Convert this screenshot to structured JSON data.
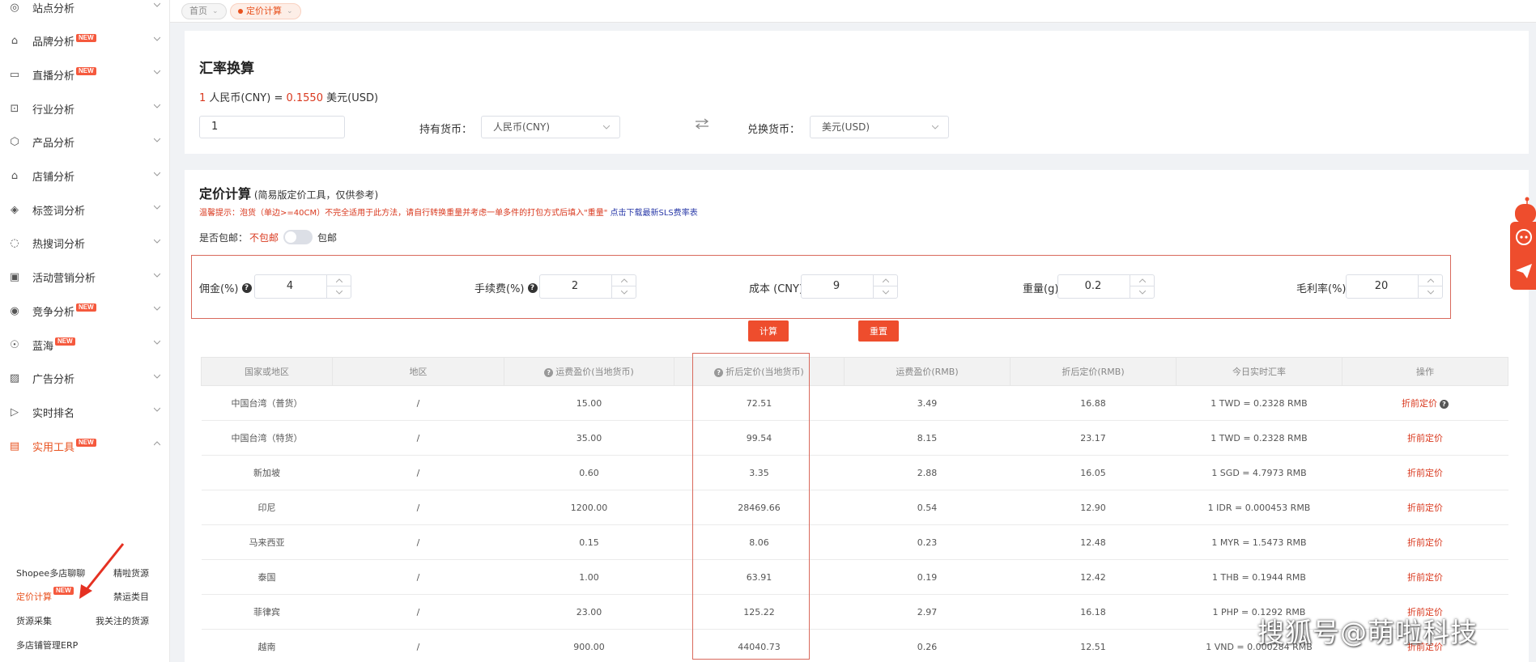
{
  "sidebar": {
    "items": [
      {
        "label": "站点分析",
        "icon": "globe-icon",
        "new": false
      },
      {
        "label": "品牌分析",
        "icon": "bag-icon",
        "new": true
      },
      {
        "label": "直播分析",
        "icon": "live-icon",
        "new": true
      },
      {
        "label": "行业分析",
        "icon": "search-doc-icon",
        "new": false
      },
      {
        "label": "产品分析",
        "icon": "box-icon",
        "new": false
      },
      {
        "label": "店铺分析",
        "icon": "shop-icon",
        "new": false
      },
      {
        "label": "标签词分析",
        "icon": "tag-icon",
        "new": false
      },
      {
        "label": "热搜词分析",
        "icon": "chat-icon",
        "new": false
      },
      {
        "label": "活动营销分析",
        "icon": "gift-icon",
        "new": false
      },
      {
        "label": "竞争分析",
        "icon": "compete-icon",
        "new": true
      },
      {
        "label": "蓝海",
        "icon": "ocean-icon",
        "new": true
      },
      {
        "label": "广告分析",
        "icon": "chart-icon",
        "new": false
      },
      {
        "label": "实时排名",
        "icon": "rank-icon",
        "new": false
      },
      {
        "label": "实用工具",
        "icon": "toolbox-icon",
        "new": true,
        "active": true
      }
    ],
    "new_badge": "NEW",
    "sub_items": [
      {
        "label": "Shopee多店聊聊"
      },
      {
        "label": "精啦货源"
      },
      {
        "label": "定价计算",
        "active": true,
        "new": true
      },
      {
        "label": "禁运类目"
      },
      {
        "label": "货源采集"
      },
      {
        "label": "我关注的货源"
      },
      {
        "label": "多店铺管理ERP"
      }
    ]
  },
  "tabs": [
    {
      "label": "首页",
      "active": false
    },
    {
      "label": "定价计算",
      "active": true
    }
  ],
  "exchange": {
    "title": "汇率换算",
    "rate_amount": "1",
    "rate_from": "人民币(CNY) =",
    "rate_value": "0.1550",
    "rate_to": "美元(USD)",
    "amount_input": "1",
    "hold_label": "持有货币：",
    "hold_value": "人民币(CNY)",
    "to_label": "兑换货币：",
    "to_value": "美元(USD)"
  },
  "pricing": {
    "title": "定价计算",
    "subtitle": "(简易版定价工具，仅供参考)",
    "tip": "温馨提示：泡货（单边>=40CM）不完全适用于此方法，请自行转换重量并考虑一单多件的打包方式后填入\"重量\"",
    "tip_link": "点击下载最新SLS费率表",
    "free_ship_label": "是否包邮：",
    "free_ship_off": "不包邮",
    "free_ship_on": "包邮",
    "fields": [
      {
        "label": "佣金(%)",
        "value": "4",
        "help": true
      },
      {
        "label": "手续费(%)",
        "value": "2",
        "help": true
      },
      {
        "label": "成本 (CNY)",
        "value": "9",
        "help": false
      },
      {
        "label": "重量(g)",
        "value": "0.2",
        "help": false
      },
      {
        "label": "毛利率(%)",
        "value": "20",
        "help": false
      }
    ],
    "calc_button": "计算",
    "reset_button": "重置"
  },
  "table": {
    "headers": [
      "国家或地区",
      "地区",
      "运费盈价(当地货币)",
      "折后定价(当地货币)",
      "运费盈价(RMB)",
      "折后定价(RMB)",
      "今日实时汇率",
      "操作"
    ],
    "rows": [
      [
        "中国台湾（普货）",
        "/",
        "15.00",
        "72.51",
        "3.49",
        "16.88",
        "1 TWD = 0.2328 RMB",
        "折前定价"
      ],
      [
        "中国台湾（特货）",
        "/",
        "35.00",
        "99.54",
        "8.15",
        "23.17",
        "1 TWD = 0.2328 RMB",
        "折前定价"
      ],
      [
        "新加坡",
        "/",
        "0.60",
        "3.35",
        "2.88",
        "16.05",
        "1 SGD = 4.7973 RMB",
        "折前定价"
      ],
      [
        "印尼",
        "/",
        "1200.00",
        "28469.66",
        "0.54",
        "12.90",
        "1 IDR = 0.000453 RMB",
        "折前定价"
      ],
      [
        "马来西亚",
        "/",
        "0.15",
        "8.06",
        "0.23",
        "12.48",
        "1 MYR = 1.5473 RMB",
        "折前定价"
      ],
      [
        "泰国",
        "/",
        "1.00",
        "63.91",
        "0.19",
        "12.42",
        "1 THB = 0.1944 RMB",
        "折前定价"
      ],
      [
        "菲律宾",
        "/",
        "23.00",
        "125.22",
        "2.97",
        "16.18",
        "1 PHP = 0.1292 RMB",
        "折前定价"
      ],
      [
        "越南",
        "/",
        "900.00",
        "44040.73",
        "0.26",
        "12.51",
        "1 VND = 0.000284 RMB",
        "折前定价"
      ]
    ]
  },
  "watermark": "搜狐号@萌啦科技",
  "colors": {
    "accent": "#ee4d2d",
    "text_red": "#d9381e",
    "border_highlight": "#d9695c"
  }
}
